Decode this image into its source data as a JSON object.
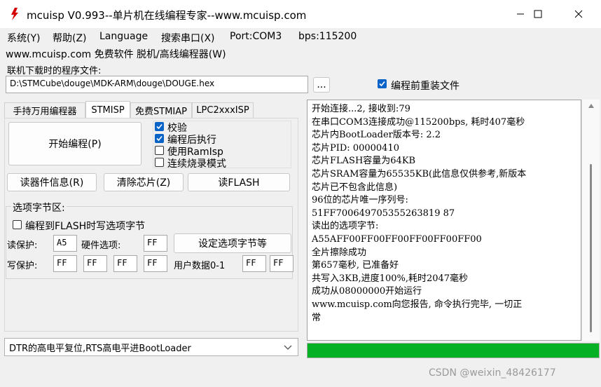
{
  "window": {
    "title": "mcuisp V0.993--单片机在线编程专家--www.mcuisp.com",
    "minimize": "—",
    "maximize": "☐",
    "close": "✕"
  },
  "menu": {
    "items": [
      "系统(Y)",
      "帮助(Z)",
      "Language",
      "搜索串口(X)",
      "Port:COM3",
      "bps:115200"
    ],
    "row2": "www.mcuisp.com 免费软件 脱机/高线编程器(W)"
  },
  "file": {
    "label": "联机下载时的程序文件:",
    "path": "D:\\STMCube\\douge\\MDK-ARM\\douge\\DOUGE.hex",
    "browse": "...",
    "reload_label": "编程前重装文件"
  },
  "tabs": [
    "手持万用编程器",
    "STMISP",
    "免费STMIAP",
    "LPC2xxxISP"
  ],
  "stmisp": {
    "start_button": "开始编程(P)",
    "options": [
      {
        "label": "校验",
        "checked": true
      },
      {
        "label": "编程后执行",
        "checked": true
      },
      {
        "label": "使用RamIsp",
        "checked": false
      },
      {
        "label": "连续烧录模式",
        "checked": false
      }
    ],
    "read_info": "读器件信息(R)",
    "erase_chip": "清除芯片(Z)",
    "read_flash": "读FLASH",
    "option_group": "选项字节区:",
    "write_option_label": "编程到FLASH时写选项字节",
    "read_protect_label": "读保护:",
    "read_protect": "A5",
    "hw_option_label": "硬件选项:",
    "hw_option": "FF",
    "set_option_button": "设定选项字节等",
    "write_protect_label": "写保护:",
    "write_protect": [
      "FF",
      "FF",
      "FF",
      "FF"
    ],
    "user_data_label": "用户数据0-1",
    "user_data": [
      "FF",
      "FF"
    ]
  },
  "bootmode": "DTR的高电平复位,RTS高电平进BootLoader",
  "log": [
    "开始连接...2, 接收到:79",
    "在串口COM3连接成功@115200bps, 耗时407毫秒",
    "芯片内BootLoader版本号: 2.2",
    "芯片PID: 00000410",
    "芯片FLASH容量为64KB",
    "芯片SRAM容量为65535KB(此信息仅供参考,新版本",
    "芯片已不包含此信息)",
    "96位的芯片唯一序列号:",
    "51FF700649705355263819 87",
    "读出的选项字节:",
    "A55AFF00FF00FF00FF00FF00FF00",
    "全片擦除成功",
    "第657毫秒, 已准备好",
    "共写入3KB,进度100%,耗时2047毫秒",
    "成功从08000000开始运行",
    "www.mcuisp.com向您报告, 命令执行完毕, 一切正",
    "常"
  ],
  "progress": 1.0,
  "colors": {
    "accent": "#0a64c8",
    "progress": "#06b025",
    "logo": "#d40000"
  },
  "watermark": "CSDN @weixin_48426177"
}
